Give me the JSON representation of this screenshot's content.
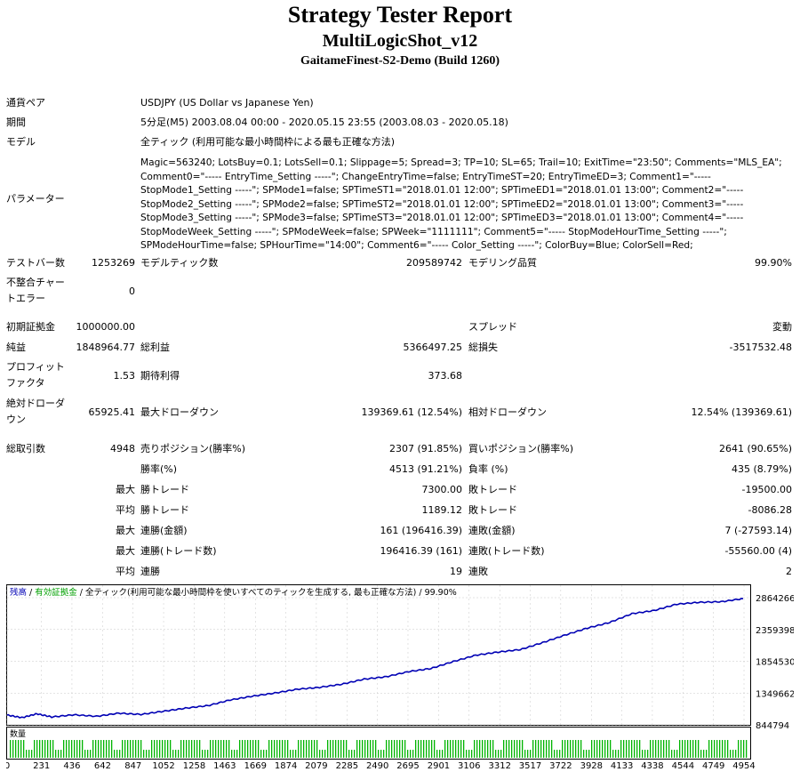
{
  "header": {
    "title": "Strategy Tester Report",
    "expert": "MultiLogicShot_v12",
    "server": "GaitameFinest-S2-Demo (Build 1260)"
  },
  "info": {
    "symbol_label": "通貨ペア",
    "symbol_value": "USDJPY (US Dollar vs Japanese Yen)",
    "period_label": "期間",
    "period_value": "5分足(M5) 2003.08.04 00:00 - 2020.05.15 23:55 (2003.08.03 - 2020.05.18)",
    "model_label": "モデル",
    "model_value": "全ティック (利用可能な最小時間枠による最も正確な方法)",
    "params_label": "パラメーター",
    "params_lines": [
      "Magic=563240; LotsBuy=0.1; LotsSell=0.1; Slippage=5; Spread=3; TP=10; SL=65; Trail=10; ExitTime=\"23:50\"; Comments=\"MLS_EA\";",
      "Comment0=\"----- EntryTime_Setting -----\"; ChangeEntryTime=false; EntryTimeST=20; EntryTimeED=3; Comment1=\"-----",
      "StopMode1_Setting -----\"; SPMode1=false; SPTimeST1=\"2018.01.01 12:00\"; SPTimeED1=\"2018.01.01 13:00\"; Comment2=\"-----",
      "StopMode2_Setting -----\"; SPMode2=false; SPTimeST2=\"2018.01.01 12:00\"; SPTimeED2=\"2018.01.01 13:00\"; Comment3=\"-----",
      "StopMode3_Setting -----\"; SPMode3=false; SPTimeST3=\"2018.01.01 12:00\"; SPTimeED3=\"2018.01.01 13:00\"; Comment4=\"-----",
      "StopModeWeek_Setting -----\"; SPModeWeek=false; SPWeek=\"1111111\"; Comment5=\"----- StopModeHourTime_Setting -----\";",
      "SPModeHourTime=false; SPHourTime=\"14:00\"; Comment6=\"----- Color_Setting -----\"; ColorBuy=Blue; ColorSell=Red;"
    ]
  },
  "stats": {
    "bars_label": "テストバー数",
    "bars_value": "1253269",
    "ticks_label": "モデルティック数",
    "ticks_value": "209589742",
    "quality_label": "モデリング品質",
    "quality_value": "99.90%",
    "mismatch_label_1": "不整合チャー",
    "mismatch_label_2": "トエラー",
    "mismatch_value": "0",
    "deposit_label": "初期証拠金",
    "deposit_value": "1000000.00",
    "spread_label": "スプレッド",
    "spread_value": "変動",
    "net_label": "純益",
    "net_value": "1848964.77",
    "gross_profit_label": "総利益",
    "gross_profit_value": "5366497.25",
    "gross_loss_label": "総損失",
    "gross_loss_value": "-3517532.48",
    "pf_label_1": "プロフィット",
    "pf_label_2": "ファクタ",
    "pf_value": "1.53",
    "payoff_label": "期待利得",
    "payoff_value": "373.68",
    "abs_dd_label_1": "絶対ドローダ",
    "abs_dd_label_2": "ウン",
    "abs_dd_value": "65925.41",
    "max_dd_label": "最大ドローダウン",
    "max_dd_value": "139369.61 (12.54%)",
    "rel_dd_label": "相対ドローダウン",
    "rel_dd_value": "12.54% (139369.61)",
    "trades_label": "総取引数",
    "trades_value": "4948",
    "short_label": "売りポジション(勝率%)",
    "short_value": "2307 (91.85%)",
    "long_label": "買いポジション(勝率%)",
    "long_value": "2641 (90.65%)",
    "win_label": "勝率(%)",
    "win_value": "4513 (91.21%)",
    "loss_label": "負率 (%)",
    "loss_value": "435 (8.79%)",
    "max_a": "最大",
    "win_trade_label": "勝トレード",
    "max_win_value": "7300.00",
    "loss_trade_label": "敗トレード",
    "max_loss_value": "-19500.00",
    "avg_a": "平均",
    "avg_win_value": "1189.12",
    "avg_loss_value": "-8086.28",
    "max_b": "最大",
    "cons_win_money_label": "連勝(金額)",
    "cons_win_money_value": "161 (196416.39)",
    "cons_loss_money_label": "連敗(金額)",
    "cons_loss_money_value": "7 (-27593.14)",
    "max_c": "最大",
    "cons_win_count_label": "連勝(トレード数)",
    "cons_win_count_value": "196416.39 (161)",
    "cons_loss_count_label": "連敗(トレード数)",
    "cons_loss_count_value": "-55560.00 (4)",
    "avg_b": "平均",
    "avg_win_streak_label": "連勝",
    "avg_win_streak_value": "19",
    "avg_loss_streak_label": "連敗",
    "avg_loss_streak_value": "2"
  },
  "chart_data": {
    "type": "line",
    "legend": {
      "balance": "残高",
      "sep1": " / ",
      "equity": "有効証拠金",
      "sep2": " / ",
      "model": "全ティック(利用可能な最小時間枠を使いすべてのティックを生成する, 最も正確な方法)",
      "sep3": " / ",
      "quality": "99.90%"
    },
    "colors": {
      "balance": "#0000b4",
      "equity": "#00a000",
      "volume": "#00b400",
      "grid": "#c8c8c8"
    },
    "ylim": [
      844794,
      2864266
    ],
    "yticks": [
      "2864266",
      "2359398",
      "1854530",
      "1349662",
      "844794"
    ],
    "xticks": [
      "0",
      "231",
      "436",
      "642",
      "847",
      "1052",
      "1258",
      "1463",
      "1669",
      "1874",
      "2079",
      "2285",
      "2490",
      "2695",
      "2901",
      "3106",
      "3312",
      "3517",
      "3722",
      "3928",
      "4133",
      "4338",
      "4544",
      "4749",
      "4954"
    ],
    "xlim": [
      0,
      4948
    ],
    "series": [
      {
        "name": "残高",
        "x": [
          0,
          100,
          200,
          300,
          450,
          600,
          750,
          900,
          1050,
          1200,
          1350,
          1500,
          1650,
          1800,
          1950,
          2100,
          2250,
          2400,
          2550,
          2700,
          2850,
          3000,
          3150,
          3300,
          3450,
          3600,
          3750,
          3900,
          4050,
          4200,
          4350,
          4500,
          4650,
          4800,
          4948
        ],
        "values": [
          1000000,
          960000,
          1020000,
          970000,
          1005000,
          980000,
          1030000,
          1010000,
          1060000,
          1110000,
          1150000,
          1240000,
          1300000,
          1350000,
          1410000,
          1440000,
          1490000,
          1570000,
          1610000,
          1690000,
          1740000,
          1850000,
          1950000,
          2000000,
          2040000,
          2150000,
          2270000,
          2380000,
          2470000,
          2610000,
          2660000,
          2760000,
          2790000,
          2800000,
          2849000
        ]
      }
    ],
    "volume_label": "数量"
  }
}
